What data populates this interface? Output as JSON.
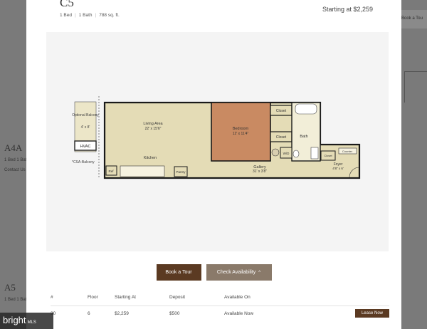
{
  "background": {
    "cards": [
      {
        "name": "A4A",
        "meta": "1 Bed  1 Bath",
        "link": "Contact Us"
      },
      {
        "name": "A5",
        "meta": "1 Bed  1 Bath",
        "link": ""
      }
    ],
    "book_tour_partial": "Book a Tou"
  },
  "modal": {
    "plan_name": "C5",
    "beds": "1 Bed",
    "baths": "1 Bath",
    "sqft": "788 sq. ft.",
    "price": "Starting at $2,259",
    "floorplan": {
      "living_area": "Living Area",
      "living_dims": "22' x 15'6\"",
      "kitchen": "Kitchen",
      "bedroom": "Bedroom",
      "bedroom_dims": "12' x 11'4\"",
      "closet1": "Closet",
      "closet2": "Closet",
      "bath": "Bath",
      "gallery": "Gallery",
      "gallery_dims": "31' x 3'8\"",
      "foyer": "Foyer",
      "foyer_dims": "4'8\" x 6'",
      "counter": "Counter",
      "closet3": "Closet",
      "pantry": "Pantry",
      "ref": "Ref",
      "wd": "W/D",
      "optional_balcony": "Optional Balcony",
      "balcony_dims": "4' x 8'",
      "hvac": "HVAC",
      "csa": "*CSA-Balcony"
    },
    "buttons": {
      "book_tour": "Book a Tour",
      "check_availability": "Check Availability",
      "chevron": "^"
    },
    "table": {
      "headers": [
        "#",
        "Floor",
        "Starting At",
        "Deposit",
        "Available On"
      ],
      "rows": [
        {
          "unit": "30",
          "floor": "6",
          "price": "$2,259",
          "deposit": "$500",
          "available": "Available Now",
          "action": "Lease Now"
        }
      ]
    }
  },
  "watermark": {
    "brand": "bright",
    "suffix": "MLS"
  }
}
